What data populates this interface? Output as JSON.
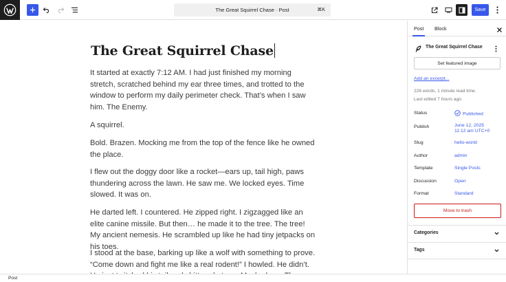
{
  "toolbar": {
    "document_title": "The Great Squirrel Chase · Post",
    "shortcut": "⌘K",
    "save_label": "Save",
    "icons": [
      "wordpress-logo",
      "plus",
      "undo",
      "redo",
      "document-overview",
      "external-view",
      "device-preview",
      "settings-sidebar",
      "more-options"
    ]
  },
  "editor": {
    "title": "The Great Squirrel Chase",
    "paragraphs": [
      "It started at exactly 7:12 AM. I had just finished my morning stretch, scratched behind my ear three times, and trotted to the window to perform my daily perimeter check. That’s when I saw him. The Enemy.",
      "A squirrel.",
      "Bold. Brazen. Mocking me from the top of the fence like he owned the place.",
      "I flew out the doggy door like a rocket—ears up, tail high, paws thundering across the lawn. He saw me. We locked eyes. Time slowed. It was on.",
      "He darted left. I countered. He zipped right. I zigzagged like an elite canine missile. But then… he made it to the tree. The tree! My ancient nemesis. He scrambled up like he had tiny jetpacks on his toes.",
      "I stood at the base, barking up like a wolf with something to prove. “Come down and fight me like a real rodent!” I howled. He didn’t. He just twitched his tail and chittered at me. Mocked me. The nerve."
    ]
  },
  "sidebar": {
    "tabs": [
      "Post",
      "Block"
    ],
    "active_tab": "Post",
    "post_title": "The Great Squirrel Chase",
    "featured_image_label": "Set featured image",
    "excerpt_link": "Add an excerpt...",
    "word_count": "226 words, 1 minute read time.",
    "last_edited": "Last edited 7 hours ago.",
    "rows": {
      "status": {
        "label": "Status",
        "value": "Published"
      },
      "publish": {
        "label": "Publish",
        "value_line1": "June 12, 2025",
        "value_line2": "11:12 am UTC+0"
      },
      "slug": {
        "label": "Slug",
        "value": "hello-world"
      },
      "author": {
        "label": "Author",
        "value": "admin"
      },
      "template": {
        "label": "Template",
        "value": "Single Posts"
      },
      "discussion": {
        "label": "Discussion",
        "value": "Open"
      },
      "format": {
        "label": "Format",
        "value": "Standard"
      }
    },
    "trash_label": "Move to trash",
    "panels": [
      "Categories",
      "Tags"
    ]
  },
  "footer": {
    "breadcrumb": "Post"
  },
  "colors": {
    "accent": "#3858e9",
    "danger": "#cc1818",
    "status_published": "#3858e9",
    "logo_bg": "#1e1e1e"
  }
}
